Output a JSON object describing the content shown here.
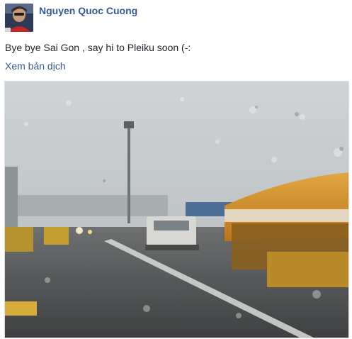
{
  "post": {
    "author_name": "Nguyen Quoc Cuong",
    "message": "Bye bye Sai Gon , say hi to Pleiku soon (-:",
    "translate_link": "Xem bản dịch"
  },
  "icons": {
    "avatar": "profile-avatar",
    "photo": "rainy-airport-window-photo"
  },
  "colors": {
    "link": "#365899",
    "text": "#1d2129",
    "border": "#dddfe2"
  }
}
